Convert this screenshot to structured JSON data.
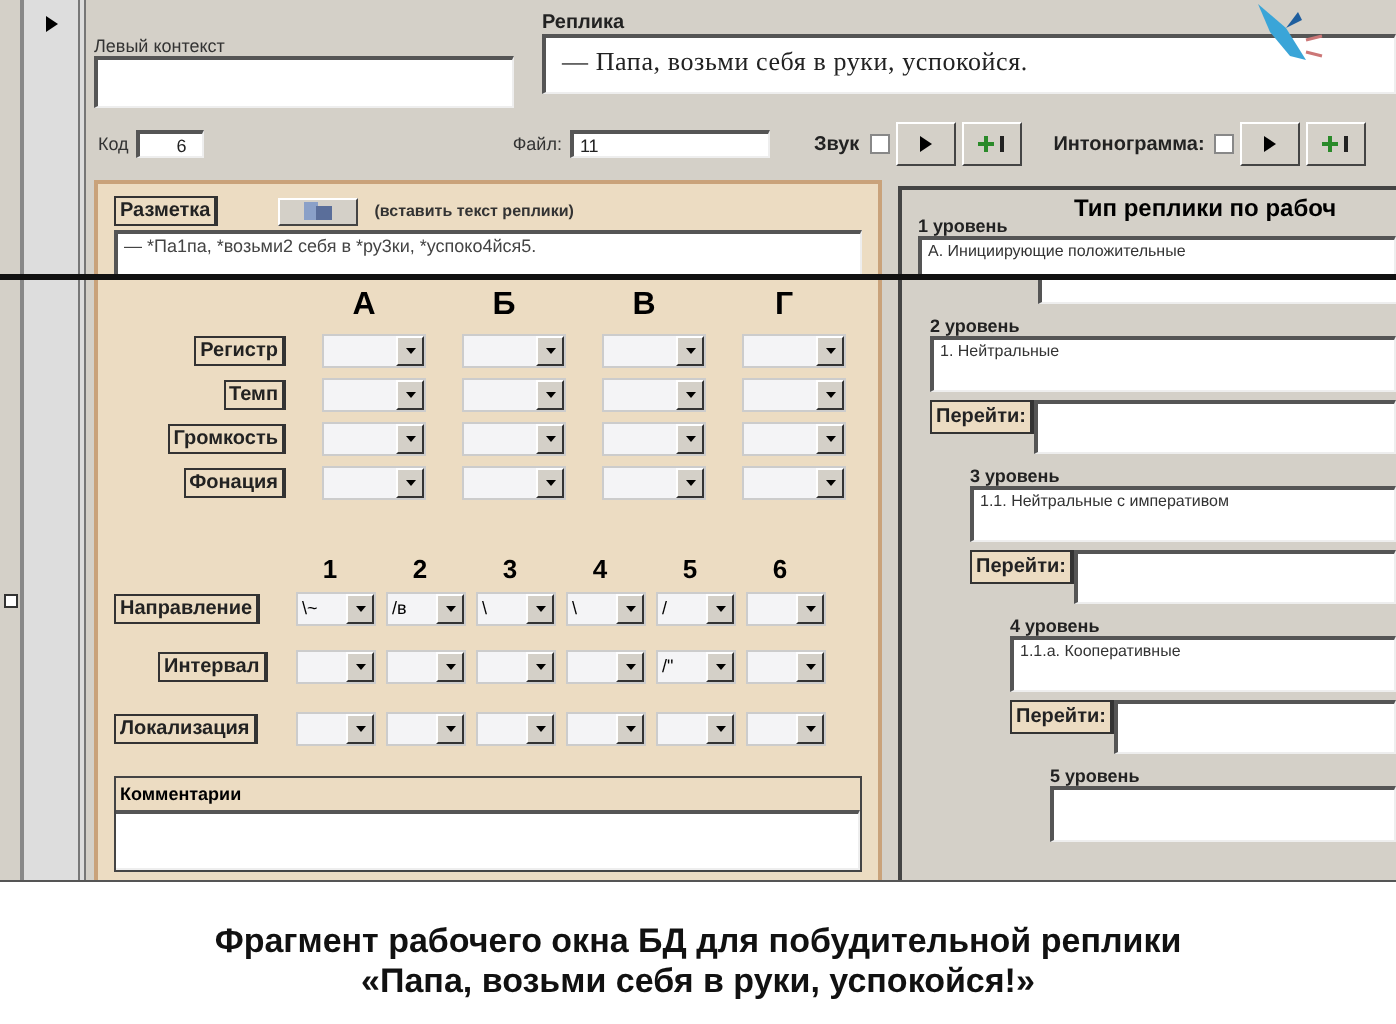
{
  "left_context": {
    "label": "Левый контекст"
  },
  "replica": {
    "label": "Реплика",
    "value": "— Папа, возьми себя в руки, успокойся."
  },
  "code": {
    "label": "Код",
    "value": "6"
  },
  "file": {
    "label": "Файл:",
    "value": "11"
  },
  "media": [
    {
      "label": "Звук",
      "checked": false
    },
    {
      "label": "Интонограмма:",
      "checked": false
    }
  ],
  "markup": {
    "label": "Разметка",
    "hint": "(вставить текст реплики)",
    "value": "— *Па1па, *возьми2 себя в *ру3ки, *успоко4йся5."
  },
  "letters": [
    "А",
    "Б",
    "В",
    "Г"
  ],
  "prosody_rows": [
    {
      "label": "Регистр",
      "combos": [
        {
          "kind": "dropdown"
        },
        {
          "kind": "dropdown"
        },
        {
          "kind": "dropdown"
        },
        {
          "kind": "dropdown"
        }
      ]
    },
    {
      "label": "Темп",
      "combos": [
        {
          "kind": "dropdown"
        },
        {
          "kind": "dropdown"
        },
        {
          "kind": "dropdown"
        },
        {
          "kind": "dropdown"
        }
      ]
    },
    {
      "label": "Громкость",
      "combos": [
        {
          "kind": "dropdown"
        },
        {
          "kind": "dropdown"
        },
        {
          "kind": "dropdown"
        },
        {
          "kind": "dropdown"
        }
      ]
    },
    {
      "label": "Фонация",
      "combos": [
        {
          "kind": "dropdown"
        },
        {
          "kind": "dropdown"
        },
        {
          "kind": "dropdown"
        },
        {
          "kind": "dropdown"
        }
      ]
    }
  ],
  "numbers": [
    "1",
    "2",
    "3",
    "4",
    "5",
    "6"
  ],
  "contour_rows": [
    {
      "label": "Направление",
      "combos": [
        {
          "kind": "dropdown",
          "value": "\\~"
        },
        {
          "kind": "dropdown",
          "value": "/в"
        },
        {
          "kind": "dropdown",
          "value": "\\"
        },
        {
          "kind": "dropdown",
          "value": "\\"
        },
        {
          "kind": "dropdown",
          "value": "/"
        },
        {
          "kind": "dropdown"
        }
      ]
    },
    {
      "label": "Интервал",
      "combos": [
        {
          "kind": "dropdown"
        },
        {
          "kind": "dropdown"
        },
        {
          "kind": "dropdown"
        },
        {
          "kind": "dropdown"
        },
        {
          "kind": "dropdown",
          "value": "/\""
        },
        {
          "kind": "dropdown"
        }
      ]
    },
    {
      "label": "Локализация",
      "combos": [
        {
          "kind": "dropdown"
        },
        {
          "kind": "dropdown"
        },
        {
          "kind": "dropdown"
        },
        {
          "kind": "dropdown"
        },
        {
          "kind": "dropdown"
        },
        {
          "kind": "dropdown"
        }
      ]
    }
  ],
  "comments": {
    "label": "Комментарии"
  },
  "type_panel": {
    "title": "Тип реплики по рабоч",
    "levels": [
      {
        "label": "1 уровень",
        "value": "А. Инициирующие положительные"
      },
      {
        "label": "2 уровень",
        "value": "1. Нейтральные",
        "go_label": "Перейти:"
      },
      {
        "label": "3 уровень",
        "value": "1.1. Нейтральные с императивом",
        "go_label": "Перейти:"
      },
      {
        "label": "4 уровень",
        "value": "1.1.а. Кооперативные",
        "go_label": "Перейти:"
      },
      {
        "label": "5 уровень"
      }
    ]
  },
  "caption": [
    "Фрагмент рабочего окна БД для побудительной реплики",
    "«Папа, возьми себя в руки, успокойся!»"
  ]
}
